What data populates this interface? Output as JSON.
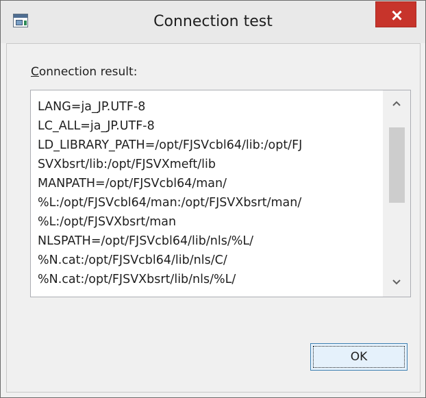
{
  "window": {
    "title": "Connection test",
    "icon": "app-icon",
    "close_icon": "close-icon"
  },
  "result": {
    "label_mnemonic": "C",
    "label_rest": "onnection result:",
    "lines": [
      "LANG=ja_JP.UTF-8",
      "LC_ALL=ja_JP.UTF-8",
      "LD_LIBRARY_PATH=/opt/FJSVcbl64/lib:/opt/FJ",
      "SVXbsrt/lib:/opt/FJSVXmeft/lib",
      "MANPATH=/opt/FJSVcbl64/man/",
      "%L:/opt/FJSVcbl64/man:/opt/FJSVXbsrt/man/",
      "%L:/opt/FJSVXbsrt/man",
      "NLSPATH=/opt/FJSVcbl64/lib/nls/%L/",
      "%N.cat:/opt/FJSVcbl64/lib/nls/C/",
      "%N.cat:/opt/FJSVXbsrt/lib/nls/%L/"
    ]
  },
  "buttons": {
    "ok_label": "OK"
  },
  "colors": {
    "close_button": "#c7342b",
    "window_background": "#f0f0f0",
    "ok_border": "#3c7fb1"
  }
}
